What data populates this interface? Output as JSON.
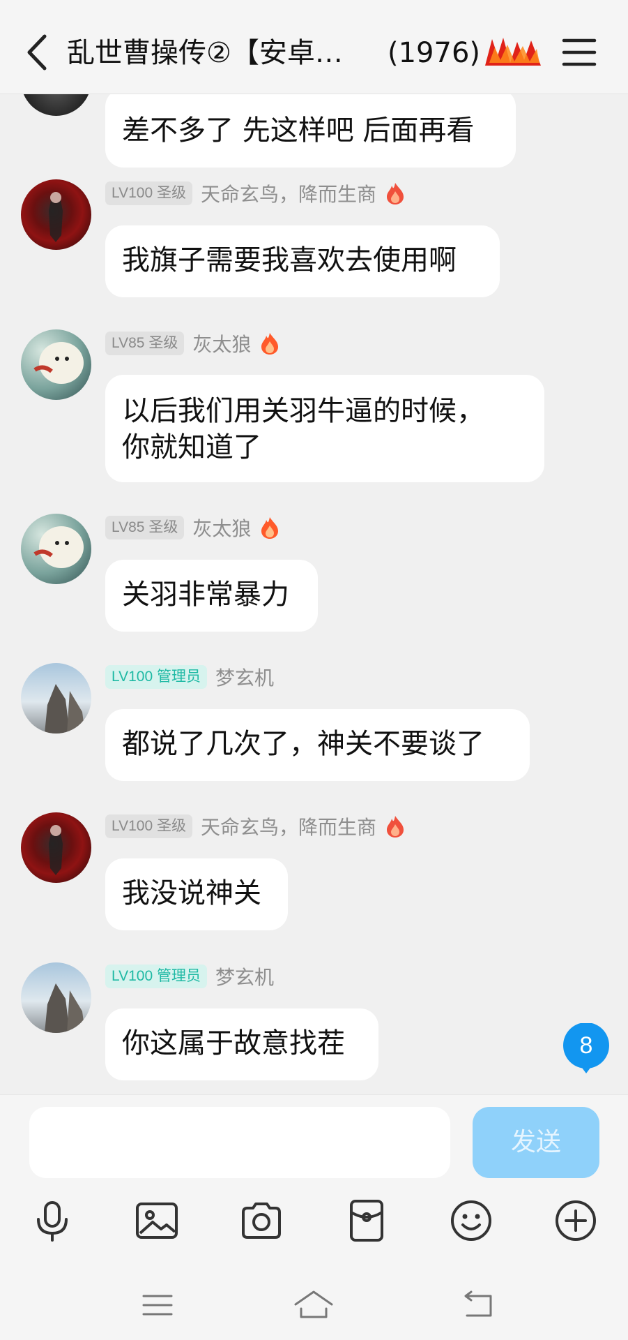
{
  "header": {
    "title": "乱世曹操传②【安卓…",
    "member_count": "(1976)"
  },
  "messages": [
    {
      "text": "差不多了 先这样吧 后面再看"
    },
    {
      "level": "LV100 圣级",
      "name": "天命玄鸟，降而生商",
      "text": "我旗子需要我喜欢去使用啊"
    },
    {
      "level": "LV85 圣级",
      "name": "灰太狼",
      "text_line1": "以后我们用关羽牛逼的时候，",
      "text_line2": "你就知道了"
    },
    {
      "level": "LV85 圣级",
      "name": "灰太狼",
      "text": "关羽非常暴力"
    },
    {
      "level": "LV100 管理员",
      "name": "梦玄机",
      "text": "都说了几次了，神关不要谈了"
    },
    {
      "level": "LV100 圣级",
      "name": "天命玄鸟，降而生商",
      "text": "我没说神关"
    },
    {
      "level": "LV100 管理员",
      "name": "梦玄机",
      "text": "你这属于故意找茬"
    }
  ],
  "unread_count": "8",
  "input": {
    "value": "",
    "send_label": "发送"
  },
  "toolbar": [
    "microphone-icon",
    "image-icon",
    "camera-icon",
    "red-packet-icon",
    "emoji-icon",
    "plus-icon"
  ],
  "colors": {
    "accent": "#1296f0",
    "send_disabled": "#8fd1fa",
    "admin_badge": "#1fb9a4"
  }
}
